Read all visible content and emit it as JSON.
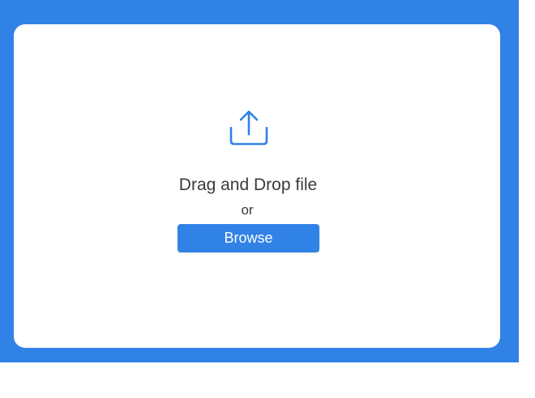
{
  "upload": {
    "icon": "upload-icon",
    "title": "Drag and Drop file",
    "or_text": "or",
    "browse_label": "Browse"
  },
  "colors": {
    "accent": "#3182e6",
    "text": "#3a3a3a",
    "background": "#ffffff"
  }
}
